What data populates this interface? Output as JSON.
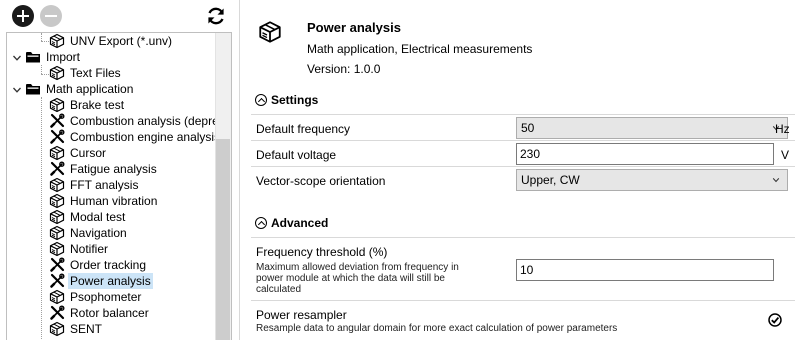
{
  "toolbar": {
    "add_icon": "plus-circle-icon",
    "remove_icon": "minus-circle-icon",
    "refresh_icon": "refresh-icon"
  },
  "tree": {
    "items": [
      {
        "label": "UNV Export (*.unv)",
        "icon": "package-icon"
      },
      {
        "label": "Import",
        "icon": "folder-icon"
      },
      {
        "label": "Text Files",
        "icon": "package-icon"
      },
      {
        "label": "Math application",
        "icon": "folder-icon"
      },
      {
        "label": "Brake test",
        "icon": "package-icon"
      },
      {
        "label": "Combustion analysis (deprecat",
        "icon": "tools-icon"
      },
      {
        "label": "Combustion engine analysis",
        "icon": "tools-icon"
      },
      {
        "label": "Cursor",
        "icon": "package-icon"
      },
      {
        "label": "Fatigue analysis",
        "icon": "tools-icon"
      },
      {
        "label": "FFT analysis",
        "icon": "package-icon"
      },
      {
        "label": "Human vibration",
        "icon": "package-icon"
      },
      {
        "label": "Modal test",
        "icon": "package-icon"
      },
      {
        "label": "Navigation",
        "icon": "package-icon"
      },
      {
        "label": "Notifier",
        "icon": "package-icon"
      },
      {
        "label": "Order tracking",
        "icon": "tools-icon"
      },
      {
        "label": "Power analysis",
        "icon": "tools-icon"
      },
      {
        "label": "Psophometer",
        "icon": "package-icon"
      },
      {
        "label": "Rotor balancer",
        "icon": "tools-icon"
      },
      {
        "label": "SENT",
        "icon": "package-icon"
      }
    ],
    "selected": "Power analysis"
  },
  "header": {
    "title": "Power analysis",
    "subtitle": "Math application, Electrical measurements",
    "version": "Version: 1.0.0"
  },
  "settings": {
    "title": "Settings",
    "default_frequency": {
      "label": "Default frequency",
      "value": "50",
      "unit": "Hz"
    },
    "default_voltage": {
      "label": "Default voltage",
      "value": "230",
      "unit": "V"
    },
    "vector_scope": {
      "label": "Vector-scope orientation",
      "value": "Upper, CW"
    }
  },
  "advanced": {
    "title": "Advanced",
    "frequency_threshold": {
      "label": "Frequency threshold (%)",
      "description_lines": [
        "Maximum allowed deviation from frequency in",
        "power module at which the data will still be",
        "calculated"
      ],
      "value": "10"
    },
    "power_resampler": {
      "label": "Power resampler",
      "description": "Resample data to angular domain for more exact calculation of power parameters",
      "checked": true
    }
  },
  "colors": {
    "selection": "#cce4f7",
    "combo_bg": "#e6e6e6",
    "divider": "#d9d9d9"
  }
}
